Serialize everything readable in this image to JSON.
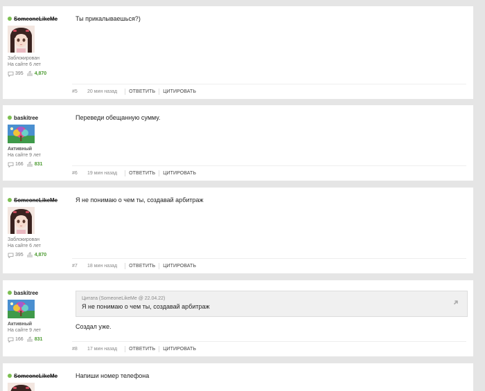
{
  "actions": {
    "reply": "ОТВЕТИТЬ",
    "quote": "ЦИТИРОВАТЬ"
  },
  "posts": [
    {
      "user": {
        "name": "SomeoneLikeMe",
        "status": "Заблокирован",
        "since": "На сайте 6 лет",
        "posts": "395",
        "reputation": "4,870",
        "avatar": "girl"
      },
      "message": "Ты прикалываешься?)",
      "number": "#5",
      "time": "20 мин назад"
    },
    {
      "user": {
        "name": "baskitree",
        "status": "Активный",
        "since": "На сайте 9 лет",
        "posts": "166",
        "reputation": "831",
        "avatar": "tree"
      },
      "message": "Переведи обещанную сумму.",
      "number": "#6",
      "time": "19 мин назад"
    },
    {
      "user": {
        "name": "SomeoneLikeMe",
        "status": "Заблокирован",
        "since": "На сайте 6 лет",
        "posts": "395",
        "reputation": "4,870",
        "avatar": "girl"
      },
      "message": "Я не понимаю о чем ты, создавай арбитраж",
      "number": "#7",
      "time": "18 мин назад"
    },
    {
      "user": {
        "name": "baskitree",
        "status": "Активный",
        "since": "На сайте 9 лет",
        "posts": "166",
        "reputation": "831",
        "avatar": "tree"
      },
      "quote": {
        "header": "Цитата (SomeoneLikeMe @ 22.04.22)",
        "text": "Я не понимаю о чем ты, создавай арбитраж"
      },
      "message": "Создал уже.",
      "number": "#8",
      "time": "17 мин назад"
    },
    {
      "user": {
        "name": "SomeoneLikeMe",
        "avatar": "girl"
      },
      "message": "Напиши номер телефона"
    }
  ]
}
